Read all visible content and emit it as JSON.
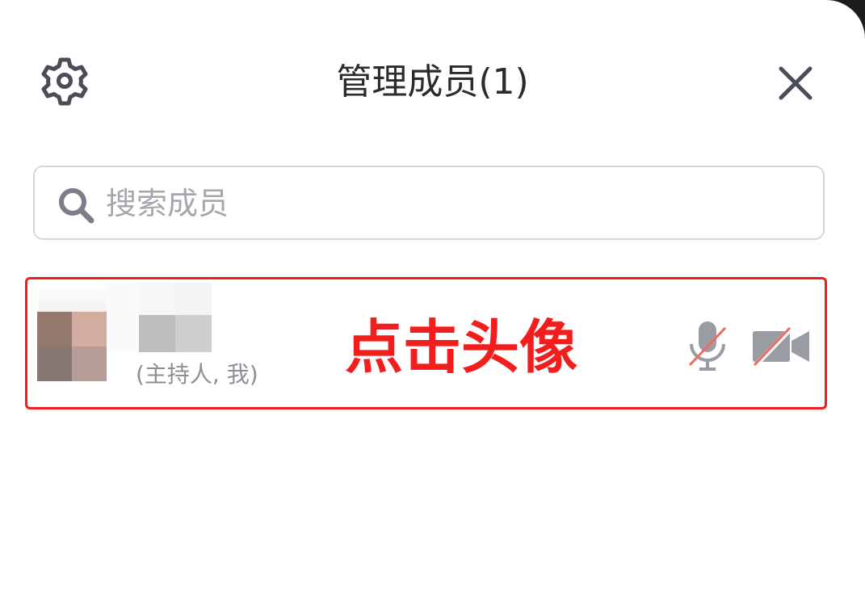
{
  "header": {
    "title": "管理成员(1)",
    "settings_icon": "gear-icon",
    "close_icon": "close-icon"
  },
  "search": {
    "placeholder": "搜索成员",
    "value": "",
    "icon": "search-icon"
  },
  "members": [
    {
      "avatar": "blurred-avatar",
      "name": "",
      "role": "(主持人, 我)",
      "mic_icon": "mic-muted-icon",
      "camera_icon": "camera-off-icon"
    }
  ],
  "annotation": {
    "text": "点击头像",
    "color": "#f21d1d"
  },
  "colors": {
    "icon_gray": "#4a4d57",
    "muted_gray": "#9a9ca3",
    "strike_red": "#f06a5e",
    "border": "#d6d7dc"
  }
}
